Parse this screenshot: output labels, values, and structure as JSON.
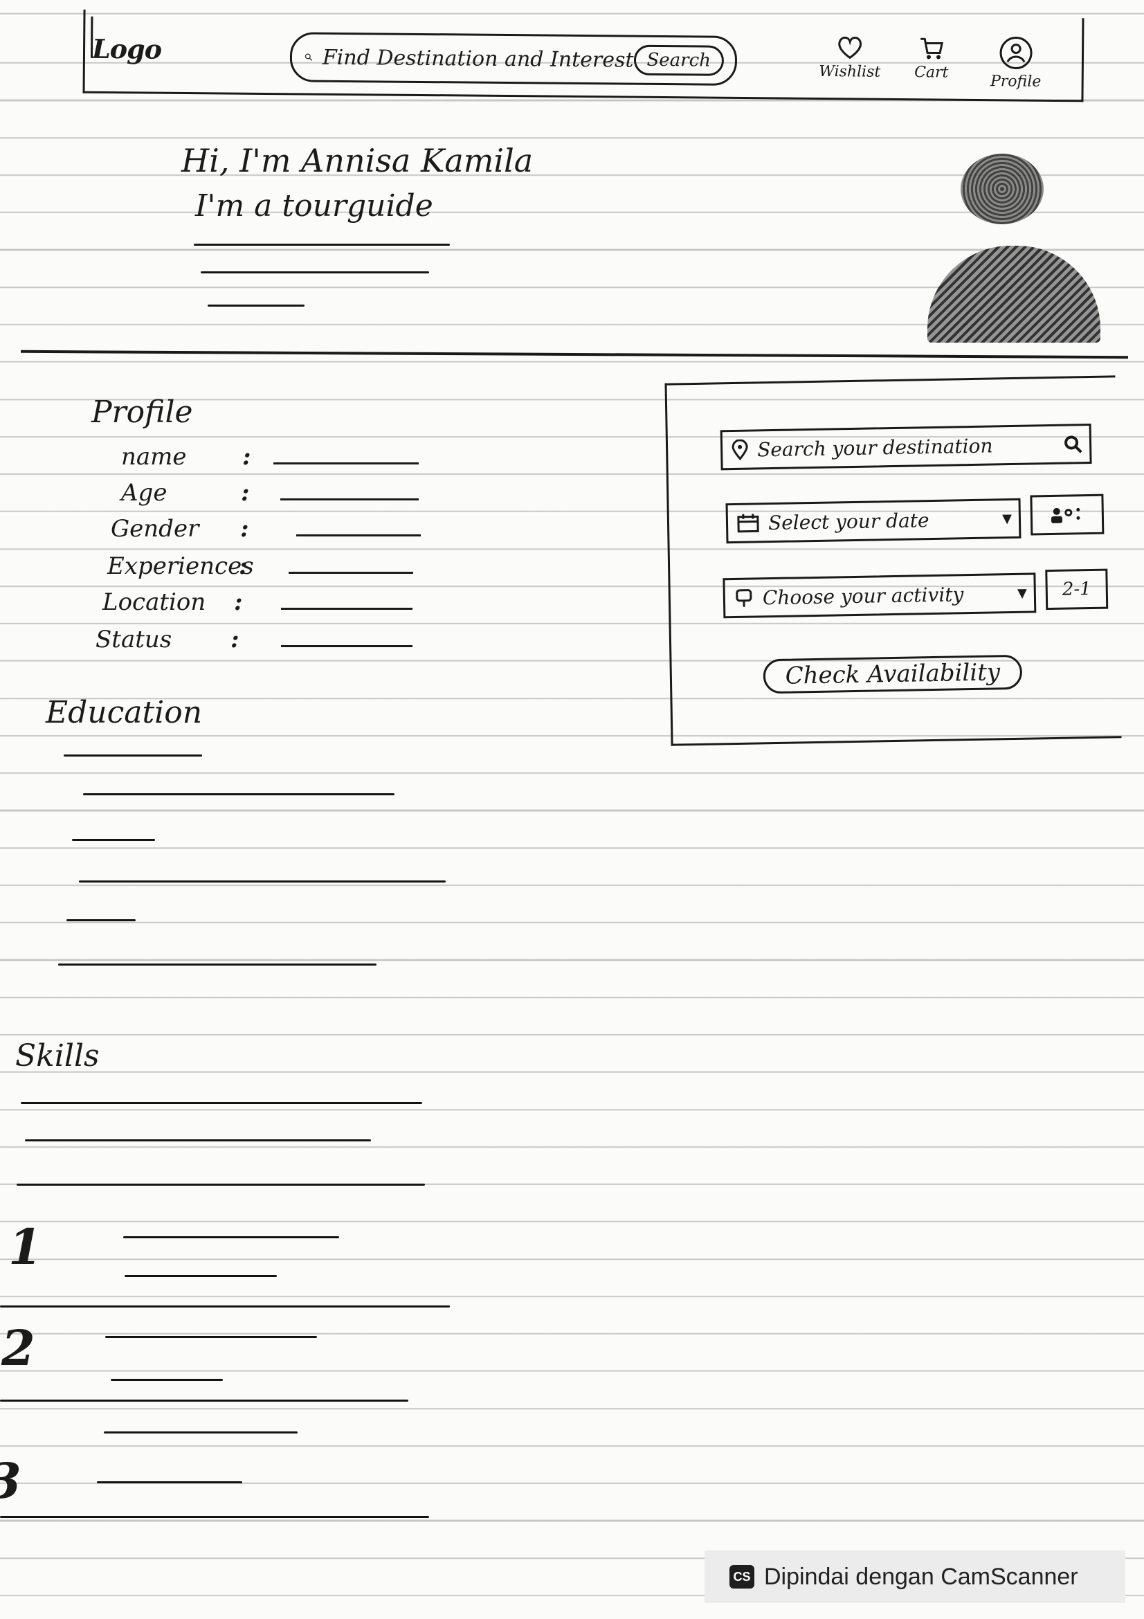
{
  "header": {
    "logo_text": "Logo",
    "search_placeholder": "Find Destination and Interest",
    "search_button": "Search",
    "nav": {
      "wishlist": "Wishlist",
      "cart": "Cart",
      "profile": "Profile"
    }
  },
  "hero": {
    "greeting": "Hi, I'm Annisa Kamila",
    "role": "I'm a tourguide"
  },
  "profile": {
    "title": "Profile",
    "fields": [
      {
        "label": "name"
      },
      {
        "label": "Age"
      },
      {
        "label": "Gender"
      },
      {
        "label": "Experiences"
      },
      {
        "label": "Location"
      },
      {
        "label": "Status"
      }
    ]
  },
  "booking": {
    "destination_placeholder": "Search your destination",
    "date_placeholder": "Select your date",
    "activity_placeholder": "Choose your activity",
    "people_count": "2-1",
    "check_button": "Check Availability"
  },
  "education": {
    "title": "Education"
  },
  "skills": {
    "title": "Skills",
    "numbers": [
      "1",
      "2",
      "3"
    ]
  },
  "footer": {
    "scanner_logo": "CS",
    "scanner_text": "Dipindai dengan CamScanner"
  }
}
